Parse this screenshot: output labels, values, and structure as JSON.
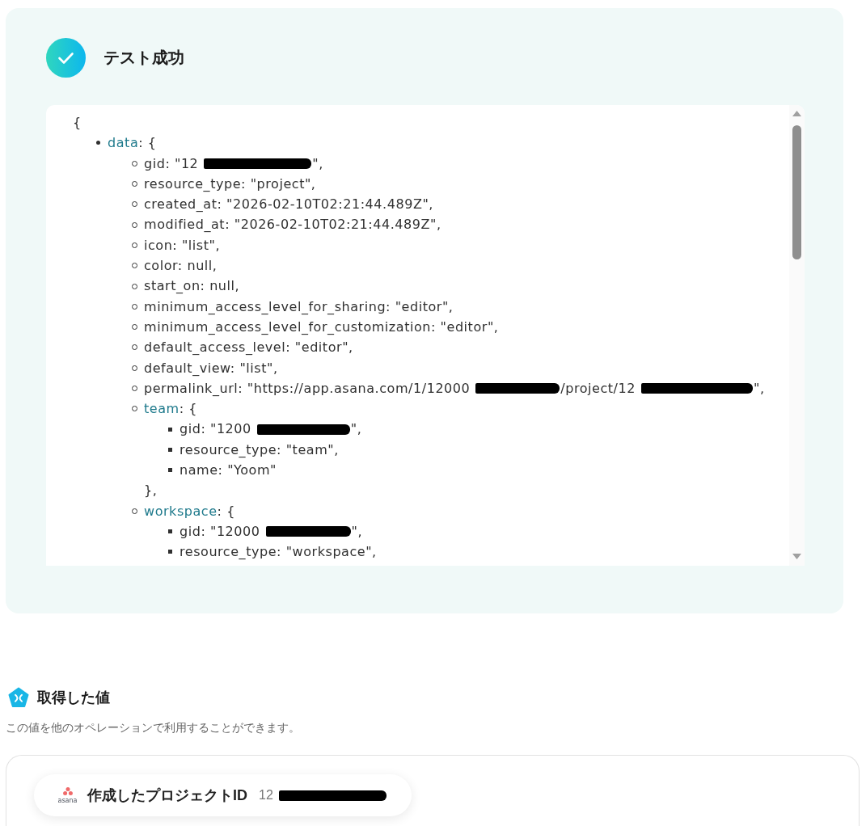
{
  "result_panel": {
    "title": "テスト成功",
    "json_viewer": {
      "opening": "{",
      "entries": [
        {
          "kind": "object",
          "key": "data",
          "opener": ": {",
          "children": [
            {
              "kind": "value",
              "segments": [
                {
                  "kind": "text",
                  "text": "gid: \"12"
                },
                {
                  "kind": "redacted"
                },
                {
                  "kind": "text",
                  "text": "\","
                }
              ]
            },
            {
              "kind": "value",
              "segments": [
                {
                  "kind": "text",
                  "text": "resource_type: \"project\","
                }
              ]
            },
            {
              "kind": "value",
              "segments": [
                {
                  "kind": "text",
                  "text": "created_at: \"2026-02-10T02:21:44.489Z\","
                }
              ]
            },
            {
              "kind": "value",
              "segments": [
                {
                  "kind": "text",
                  "text": "modified_at: \"2026-02-10T02:21:44.489Z\","
                }
              ]
            },
            {
              "kind": "value",
              "segments": [
                {
                  "kind": "text",
                  "text": "icon: \"list\","
                }
              ]
            },
            {
              "kind": "value",
              "segments": [
                {
                  "kind": "text",
                  "text": "color: null,"
                }
              ]
            },
            {
              "kind": "value",
              "segments": [
                {
                  "kind": "text",
                  "text": "start_on: null,"
                }
              ]
            },
            {
              "kind": "value",
              "segments": [
                {
                  "kind": "text",
                  "text": "minimum_access_level_for_sharing: \"editor\","
                }
              ]
            },
            {
              "kind": "value",
              "segments": [
                {
                  "kind": "text",
                  "text": "minimum_access_level_for_customization: \"editor\","
                }
              ]
            },
            {
              "kind": "value",
              "segments": [
                {
                  "kind": "text",
                  "text": "default_access_level: \"editor\","
                }
              ]
            },
            {
              "kind": "value",
              "segments": [
                {
                  "kind": "text",
                  "text": "default_view: \"list\","
                }
              ]
            },
            {
              "kind": "value",
              "segments": [
                {
                  "kind": "text",
                  "text": "permalink_url: \"https://app.asana.com/1/12000"
                },
                {
                  "kind": "redacted"
                },
                {
                  "kind": "text",
                  "text": "/project/12"
                },
                {
                  "kind": "redacted"
                },
                {
                  "kind": "text",
                  "text": "\","
                }
              ]
            },
            {
              "kind": "object",
              "key": "team",
              "opener": ": {",
              "children": [
                {
                  "kind": "value",
                  "segments": [
                    {
                      "kind": "text",
                      "text": "gid: \"1200"
                    },
                    {
                      "kind": "redacted"
                    },
                    {
                      "kind": "text",
                      "text": "\","
                    }
                  ]
                },
                {
                  "kind": "value",
                  "segments": [
                    {
                      "kind": "text",
                      "text": "resource_type: \"team\","
                    }
                  ]
                },
                {
                  "kind": "value",
                  "segments": [
                    {
                      "kind": "text",
                      "text": "name: \"Yoom\""
                    }
                  ]
                }
              ],
              "closer": "},"
            },
            {
              "kind": "object",
              "key": "workspace",
              "opener": ": {",
              "children": [
                {
                  "kind": "value",
                  "segments": [
                    {
                      "kind": "text",
                      "text": "gid: \"12000"
                    },
                    {
                      "kind": "redacted"
                    },
                    {
                      "kind": "text",
                      "text": "\","
                    }
                  ]
                },
                {
                  "kind": "value",
                  "segments": [
                    {
                      "kind": "text",
                      "text": "resource_type: \"workspace\","
                    }
                  ]
                }
              ]
            }
          ]
        }
      ]
    }
  },
  "output_section": {
    "title": "取得した値",
    "description": "この値を他のオペレーションで利用することができます。",
    "values": [
      {
        "logo_text": "asana",
        "label": "作成したプロジェクトID",
        "segments": [
          {
            "kind": "text",
            "text": "12"
          },
          {
            "kind": "redacted"
          }
        ]
      }
    ]
  }
}
